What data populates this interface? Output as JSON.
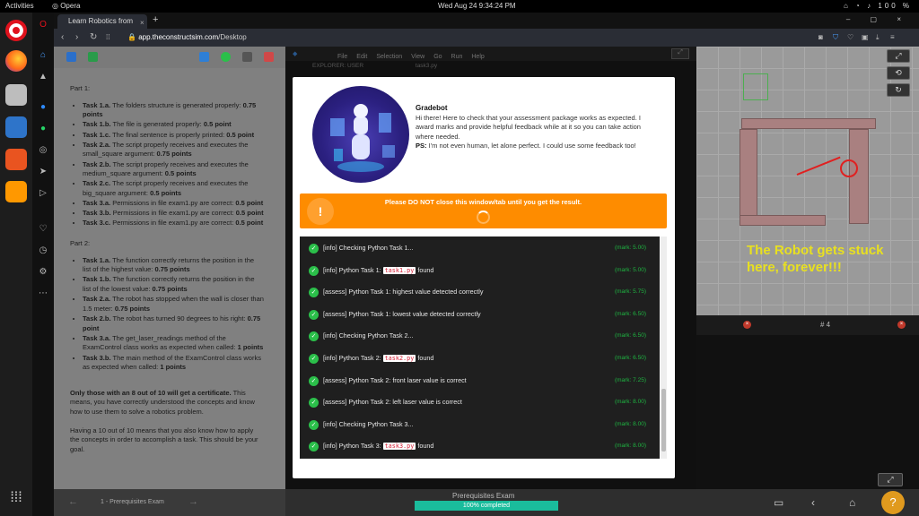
{
  "os_bar": {
    "activities": "Activities",
    "browser": "Opera",
    "clock": "Wed Aug 24  9:34:24 PM",
    "battery": "100 %"
  },
  "browser": {
    "tab_title": "Learn Robotics from",
    "url_host": "app.theconstructsim.com",
    "url_path": "/Desktop"
  },
  "left_panel": {
    "part1_title": "Part 1:",
    "part1_tasks": [
      {
        "label": "Task 1.a.",
        "text": " The folders structure is generated properly: ",
        "points": "0.75 points"
      },
      {
        "label": "Task 1.b.",
        "text": " The file is generated properly: ",
        "points": "0.5 point"
      },
      {
        "label": "Task 1.c.",
        "text": " The final sentence is properly printed: ",
        "points": "0.5 point"
      },
      {
        "label": "Task 2.a.",
        "text": " The script properly receives and executes the small_square argument: ",
        "points": "0.75 points"
      },
      {
        "label": "Task 2.b.",
        "text": " The script properly receives and executes the medium_square argument: ",
        "points": "0.5 points"
      },
      {
        "label": "Task 2.c.",
        "text": " The script properly receives and executes the big_square argument: ",
        "points": "0.5 points"
      },
      {
        "label": "Task 3.a.",
        "text": " Permissions in file exam1.py are correct: ",
        "points": "0.5 point"
      },
      {
        "label": "Task 3.b.",
        "text": " Permissions in file exam1.py are correct: ",
        "points": "0.5 point"
      },
      {
        "label": "Task 3.c.",
        "text": " Permissions in file exam1.py are correct: ",
        "points": "0.5 point"
      }
    ],
    "part2_title": "Part 2:",
    "part2_tasks": [
      {
        "label": "Task 1.a.",
        "text": " The function correctly returns the position in the list of the highest value: ",
        "points": "0.75 points"
      },
      {
        "label": "Task 1.b.",
        "text": " The function correctly returns the position in the list of the lowest value: ",
        "points": "0.75 points"
      },
      {
        "label": "Task 2.a.",
        "text": " The robot has stopped when the wall is closer than 1.5 meter: ",
        "points": "0.75 points"
      },
      {
        "label": "Task 2.b.",
        "text": " The robot has turned 90 degrees to his right: ",
        "points": "0.75 point"
      },
      {
        "label": "Task 3.a.",
        "text": " The get_laser_readings method of the ExamControl class works as expected when called: ",
        "points": "1 points"
      },
      {
        "label": "Task 3.b.",
        "text": " The main method of the ExamControl class works as expected when called: ",
        "points": "1 points"
      }
    ],
    "cert_bold": "Only those with an 8 out of 10 will get a certificate.",
    "cert_rest": " This means, you have correctly understood the concepts and know how to use them to solve a robotics problem.",
    "perfect_text": "Having a 10 out of 10 means that you also know how to apply the concepts in order to accomplish a task. This should be your goal."
  },
  "ide": {
    "menu": [
      "File",
      "Edit",
      "Selection",
      "View",
      "Go",
      "Run",
      "Help"
    ],
    "explorer": "EXPLORER: USER",
    "file_tab": "task3.py"
  },
  "scene": {
    "message": "The Robot gets stuck here, forever!!!"
  },
  "terminal": {
    "tab_label": "# 4"
  },
  "gradebot": {
    "title": "Gradebot",
    "intro": "Hi there! Here to check that your assessment package works as expected. I award marks and provide helpful feedback while at it so you can take action where needed.",
    "ps_label": "PS:",
    "ps_text": " I'm not even human, let alone perfect. I could use some feedback too!",
    "warning": "Please DO NOT close this window/tab until you get the result.",
    "warning_icon": "!"
  },
  "log": [
    {
      "pre": "[info] Checking Python Task 1...",
      "code": "",
      "post": "",
      "mark": "(mark: 5.00)"
    },
    {
      "pre": "[info] Python Task 1: ",
      "code": "task1.py",
      "post": " found",
      "mark": "(mark: 5.00)"
    },
    {
      "pre": "[assess] Python Task 1: highest value detected correctly",
      "code": "",
      "post": "",
      "mark": "(mark: 5.75)"
    },
    {
      "pre": "[assess] Python Task 1: lowest value detected correctly",
      "code": "",
      "post": "",
      "mark": "(mark: 6.50)"
    },
    {
      "pre": "[info] Checking Python Task 2...",
      "code": "",
      "post": "",
      "mark": "(mark: 6.50)"
    },
    {
      "pre": "[info] Python Task 2: ",
      "code": "task2.py",
      "post": " found",
      "mark": "(mark: 6.50)"
    },
    {
      "pre": "[assess] Python Task 2: front laser value is correct",
      "code": "",
      "post": "",
      "mark": "(mark: 7.25)"
    },
    {
      "pre": "[assess] Python Task 2: left laser value is correct",
      "code": "",
      "post": "",
      "mark": "(mark: 8.00)"
    },
    {
      "pre": "[info] Checking Python Task 3...",
      "code": "",
      "post": "",
      "mark": "(mark: 8.00)"
    },
    {
      "pre": "[info] Python Task 3: ",
      "code": "task3.py",
      "post": " found",
      "mark": "(mark: 8.00)"
    }
  ],
  "bottom": {
    "prev_label": "1 - Prerequisites Exam",
    "exam_title": "Prerequisites Exam",
    "progress": "100% completed",
    "progress_value": 100,
    "help": "?"
  },
  "colors": {
    "accent_orange": "#fe8c00",
    "success_green": "#2bbf4a",
    "progress_teal": "#1abc9c",
    "opera_red": "#e0121d"
  },
  "icons": [
    "opera-icon",
    "firefox-icon",
    "files-icon",
    "docs-icon",
    "software-icon",
    "sublime-icon",
    "apps-grid-icon",
    "home-icon",
    "messenger-icon",
    "whatsapp-icon",
    "instagram-icon",
    "play-icon",
    "heart-icon",
    "history-icon",
    "settings-icon",
    "more-icon",
    "expand-icon",
    "rotate-icon",
    "refresh-icon",
    "close-icon",
    "monitor-icon",
    "home-icon",
    "question-icon"
  ]
}
